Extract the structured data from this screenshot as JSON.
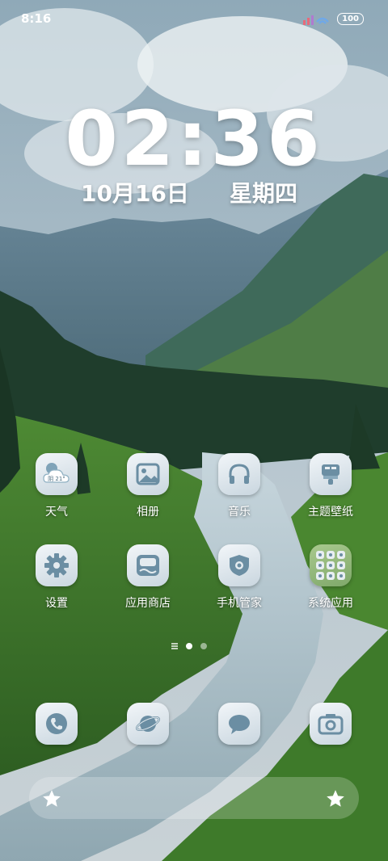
{
  "status_bar": {
    "time": "8:16",
    "battery": "100"
  },
  "lockclock": {
    "time": "02:36",
    "date": "10月16日",
    "weekday": "星期四"
  },
  "apps": [
    {
      "label": "天气",
      "icon": "weather-icon",
      "badge": "阴 21°"
    },
    {
      "label": "相册",
      "icon": "gallery-icon"
    },
    {
      "label": "音乐",
      "icon": "headphones-icon"
    },
    {
      "label": "主题壁纸",
      "icon": "theme-icon"
    },
    {
      "label": "设置",
      "icon": "gear-icon"
    },
    {
      "label": "应用商店",
      "icon": "app-store-icon"
    },
    {
      "label": "手机管家",
      "icon": "shield-icon"
    },
    {
      "label": "系统应用",
      "icon": "folder-icon"
    }
  ],
  "dock": [
    {
      "icon": "phone-icon"
    },
    {
      "icon": "browser-icon"
    },
    {
      "icon": "message-icon"
    },
    {
      "icon": "camera-icon"
    }
  ],
  "colors": {
    "icon_tint": "#5a7f95",
    "tile_bg": "#dfe7ec"
  }
}
